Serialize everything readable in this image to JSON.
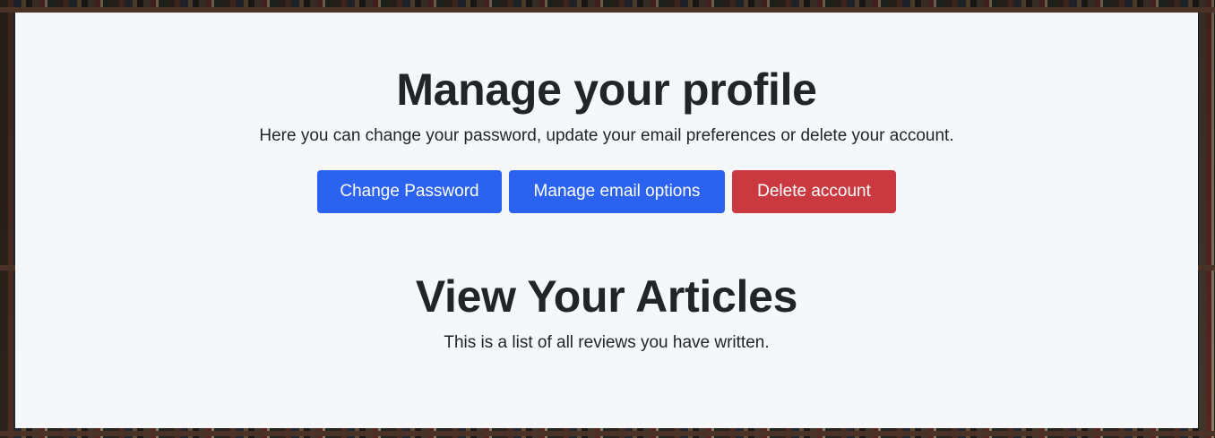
{
  "profile": {
    "title": "Manage your profile",
    "description": "Here you can change your password, update your email preferences or delete your account.",
    "buttons": {
      "change_password": "Change Password",
      "manage_email": "Manage email options",
      "delete_account": "Delete account"
    }
  },
  "articles": {
    "title": "View Your Articles",
    "description": "This is a list of all reviews you have written.",
    "items": []
  },
  "colors": {
    "primary": "#2b63f0",
    "danger": "#c9393f",
    "panel_background": "#f6f7f9",
    "text": "#212529"
  }
}
